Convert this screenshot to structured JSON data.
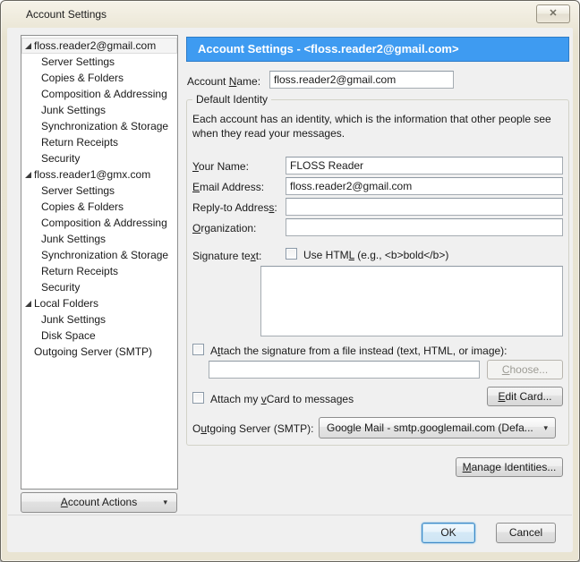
{
  "window": {
    "title": "Account Settings",
    "close_glyph": "✕"
  },
  "sidebar": {
    "tree": [
      {
        "label": "floss.reader2@gmail.com",
        "level": 0,
        "expanded": true,
        "selected": true
      },
      {
        "label": "Server Settings",
        "level": 1
      },
      {
        "label": "Copies & Folders",
        "level": 1
      },
      {
        "label": "Composition & Addressing",
        "level": 1
      },
      {
        "label": "Junk Settings",
        "level": 1
      },
      {
        "label": "Synchronization & Storage",
        "level": 1
      },
      {
        "label": "Return Receipts",
        "level": 1
      },
      {
        "label": "Security",
        "level": 1
      },
      {
        "label": "floss.reader1@gmx.com",
        "level": 0,
        "expanded": true
      },
      {
        "label": "Server Settings",
        "level": 1
      },
      {
        "label": "Copies & Folders",
        "level": 1
      },
      {
        "label": "Composition & Addressing",
        "level": 1
      },
      {
        "label": "Junk Settings",
        "level": 1
      },
      {
        "label": "Synchronization & Storage",
        "level": 1
      },
      {
        "label": "Return Receipts",
        "level": 1
      },
      {
        "label": "Security",
        "level": 1
      },
      {
        "label": "Local Folders",
        "level": 0,
        "expanded": true
      },
      {
        "label": "Junk Settings",
        "level": 1
      },
      {
        "label": "Disk Space",
        "level": 1
      },
      {
        "label": "Outgoing Server (SMTP)",
        "level": 0
      }
    ],
    "account_actions_label": "&Account Actions",
    "dropdown_arrow": "▾"
  },
  "main": {
    "header_title": "Account Settings - <floss.reader2@gmail.com>",
    "account_name": {
      "label": "Account &Name:",
      "value": "floss.reader2@gmail.com"
    },
    "identity": {
      "legend": "Default Identity",
      "description_line1": "Each account has an identity, which is the information that other people see",
      "description_line2": "when they read your messages.",
      "your_name": {
        "label": "&Your Name:",
        "value": "FLOSS Reader"
      },
      "email": {
        "label": "&Email Address:",
        "value": "floss.reader2@gmail.com"
      },
      "reply_to": {
        "label": "Reply-to Addres&s:",
        "value": ""
      },
      "organization": {
        "label": "&Organization:",
        "value": ""
      },
      "signature": {
        "label": "Signature te&xt:",
        "use_html_label": "Use HTM&L (e.g., <b>bold</b>)",
        "use_html_checked": false,
        "text": ""
      },
      "attach_file": {
        "label": "A&ttach the signature from a file instead (text, HTML, or image):",
        "checked": false,
        "path": "",
        "choose_label": "&Choose...",
        "choose_enabled": false
      },
      "vcard": {
        "label": "Attach my &vCard to messages",
        "checked": false,
        "edit_card_label": "&Edit Card..."
      },
      "outgoing_server": {
        "label": "O&utgoing Server (SMTP):",
        "value": "Google Mail - smtp.googlemail.com (Defa...",
        "arrow": "▾"
      }
    },
    "manage_identities_label": "&Manage Identities..."
  },
  "footer": {
    "ok_label": "OK",
    "cancel_label": "Cancel"
  },
  "colors": {
    "header_bg": "#3e9bf1",
    "header_text": "#ffffff",
    "frame_bg": "#e9e4d2",
    "client_bg": "#f0f0f0"
  }
}
